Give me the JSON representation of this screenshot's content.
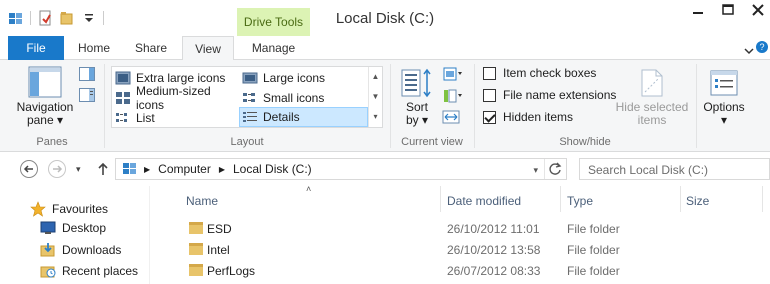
{
  "window": {
    "title": "Local Disk (C:)",
    "contextual_tab": "Drive Tools"
  },
  "tabs": [
    {
      "label": "File"
    },
    {
      "label": "Home"
    },
    {
      "label": "Share"
    },
    {
      "label": "View"
    },
    {
      "label": "Manage"
    }
  ],
  "help_label": "?",
  "ribbon": {
    "panes": {
      "navigation_pane": "Navigation",
      "navigation_pane_line2": "pane",
      "group_label": "Panes"
    },
    "layout": {
      "items": [
        {
          "label": "Extra large icons"
        },
        {
          "label": "Large icons"
        },
        {
          "label": "Medium-sized icons"
        },
        {
          "label": "Small icons"
        },
        {
          "label": "List"
        },
        {
          "label": "Details",
          "selected": true
        }
      ],
      "group_label": "Layout"
    },
    "current_view": {
      "sort_by": "Sort",
      "sort_by_line2": "by",
      "group_label": "Current view"
    },
    "show_hide": {
      "item_check_boxes": {
        "label": "Item check boxes",
        "checked": false
      },
      "file_name_extensions": {
        "label": "File name extensions",
        "checked": false
      },
      "hidden_items": {
        "label": "Hidden items",
        "checked": true
      },
      "hide_selected_items": "Hide selected",
      "hide_selected_items_line2": "items",
      "group_label": "Show/hide"
    },
    "options": {
      "label": "Options"
    }
  },
  "address_bar": {
    "segments": [
      "Computer",
      "Local Disk (C:)"
    ],
    "search_placeholder": "Search Local Disk (C:)"
  },
  "nav_pane": {
    "items": [
      {
        "label": "Favourites",
        "icon": "star-icon"
      },
      {
        "label": "Desktop",
        "icon": "desktop-icon"
      },
      {
        "label": "Downloads",
        "icon": "downloads-icon"
      },
      {
        "label": "Recent places",
        "icon": "recent-places-icon"
      }
    ]
  },
  "file_list": {
    "columns": [
      "Name",
      "Date modified",
      "Type",
      "Size"
    ],
    "rows": [
      {
        "name": "ESD",
        "date": "26/10/2012 11:01",
        "type": "File folder",
        "size": ""
      },
      {
        "name": "Intel",
        "date": "26/10/2012 13:58",
        "type": "File folder",
        "size": ""
      },
      {
        "name": "PerfLogs",
        "date": "26/07/2012 08:33",
        "type": "File folder",
        "size": ""
      }
    ]
  },
  "colors": {
    "file_tab": "#1979ca",
    "contextual_tab": "#dcf3b4",
    "selection": "#cce8ff",
    "column_header_text": "#4c607a"
  }
}
